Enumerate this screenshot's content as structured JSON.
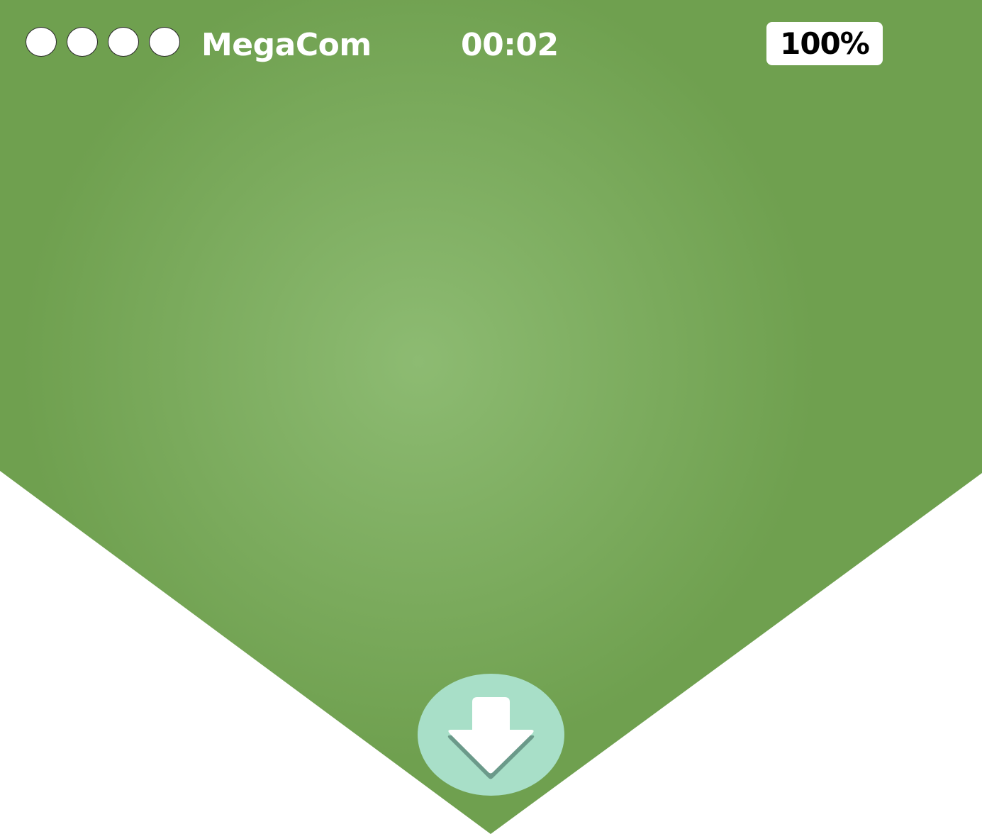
{
  "status_bar": {
    "signal_bars": 4,
    "carrier": "MegaCom",
    "time": "00:02",
    "battery": "100%"
  },
  "colors": {
    "background_green": "#6fa04f",
    "background_green_center": "#8dbb72",
    "outside": "#ffffff",
    "button_fill": "#a8dfc8",
    "arrow": "#ffffff",
    "arrow_shadow": "#6b9a8a"
  },
  "icons": {
    "signal": "signal-dot-icon",
    "download": "download-arrow-icon"
  }
}
